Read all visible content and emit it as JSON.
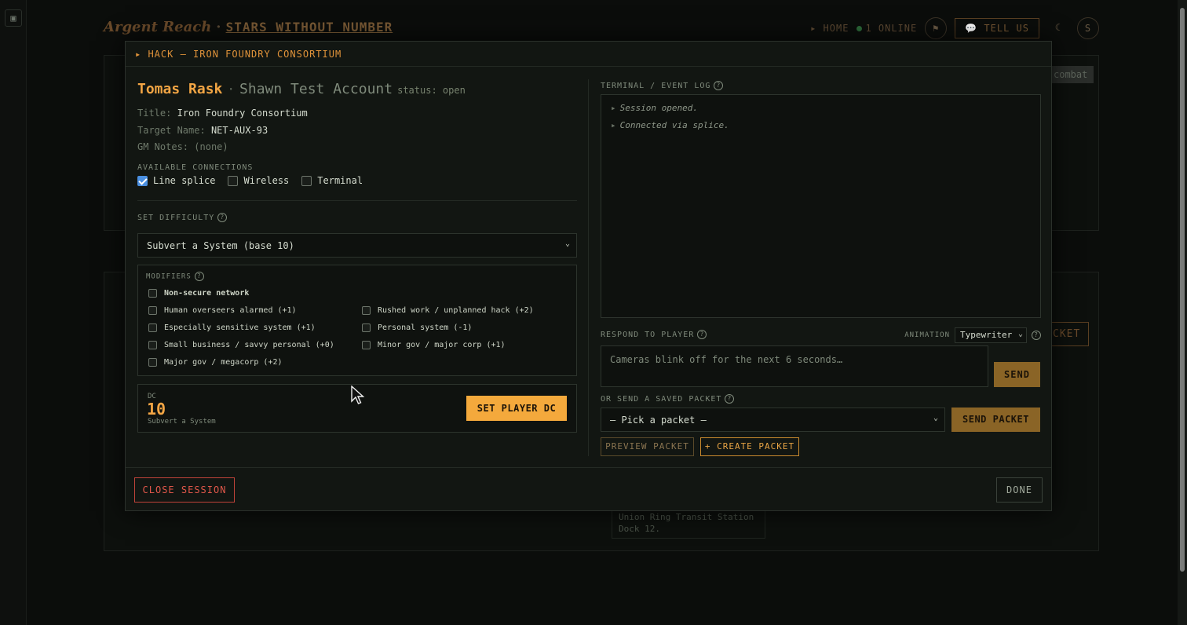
{
  "app": {
    "brand": "Argent Reach",
    "brand_sep": "·",
    "game": "STARS WITHOUT NUMBER",
    "nav_home": "▸ HOME",
    "online": "1 ONLINE",
    "tell_us": "TELL US",
    "avatar_letter": "S",
    "bg_combat": "combat",
    "bg_packet": "CKET",
    "bg_card_line1": "Union Ring Transit Station",
    "bg_card_line2": "Dock 12."
  },
  "modal": {
    "title": "▸ HACK — IRON FOUNDRY CONSORTIUM",
    "character": "Tomas Rask",
    "separator": "·",
    "account": "Shawn Test Account",
    "status": "status: open",
    "fields": {
      "title_label": "Title:",
      "title_value": "Iron Foundry Consortium",
      "target_label": "Target Name:",
      "target_value": "NET-AUX-93",
      "gm_label": "GM Notes:",
      "gm_value": "(none)"
    },
    "connections_label": "AVAILABLE CONNECTIONS",
    "connections": [
      {
        "label": "Line splice",
        "checked": true
      },
      {
        "label": "Wireless",
        "checked": false
      },
      {
        "label": "Terminal",
        "checked": false
      }
    ],
    "difficulty_label": "SET DIFFICULTY",
    "difficulty_selected": "Subvert a System (base 10)",
    "modifiers_label": "MODIFIERS",
    "modifiers": [
      {
        "label": "Non-secure network",
        "checked": false
      },
      {
        "label": "Human overseers alarmed (+1)",
        "checked": false
      },
      {
        "label": "Rushed work / unplanned hack (+2)",
        "checked": false
      },
      {
        "label": "Especially sensitive system (+1)",
        "checked": false
      },
      {
        "label": "Personal system (-1)",
        "checked": false
      },
      {
        "label": "Small business / savvy personal (+0)",
        "checked": false
      },
      {
        "label": "Minor gov / major corp (+1)",
        "checked": false
      },
      {
        "label": "Major gov / megacorp (+2)",
        "checked": false
      }
    ],
    "dc_label": "DC",
    "dc_value": "10",
    "dc_sub": "Subvert a System",
    "set_dc_button": "SET PLAYER DC",
    "log_label": "TERMINAL / EVENT LOG",
    "log_bullet": "▸",
    "log": [
      "Session opened.",
      "Connected via splice."
    ],
    "respond_label": "RESPOND TO PLAYER",
    "animation_label": "ANIMATION",
    "animation_value": "Typewriter",
    "reply_placeholder": "Cameras blink off for the next 6 seconds…",
    "send_button": "SEND",
    "saved_packet_label": "OR SEND A SAVED PACKET",
    "packet_placeholder": "— Pick a packet —",
    "send_packet_button": "SEND PACKET",
    "preview_button": "PREVIEW PACKET",
    "create_button": "+ CREATE PACKET",
    "close_button": "CLOSE SESSION",
    "done_button": "DONE"
  },
  "icons": {
    "help": "?",
    "chevron": "⌄",
    "flag": "⚑",
    "moon": "☾",
    "chat": "💬",
    "logo": "▣"
  },
  "colors": {
    "accent": "#f4a93c",
    "danger": "#e0574a",
    "checkbox": "#4a8fe0"
  }
}
